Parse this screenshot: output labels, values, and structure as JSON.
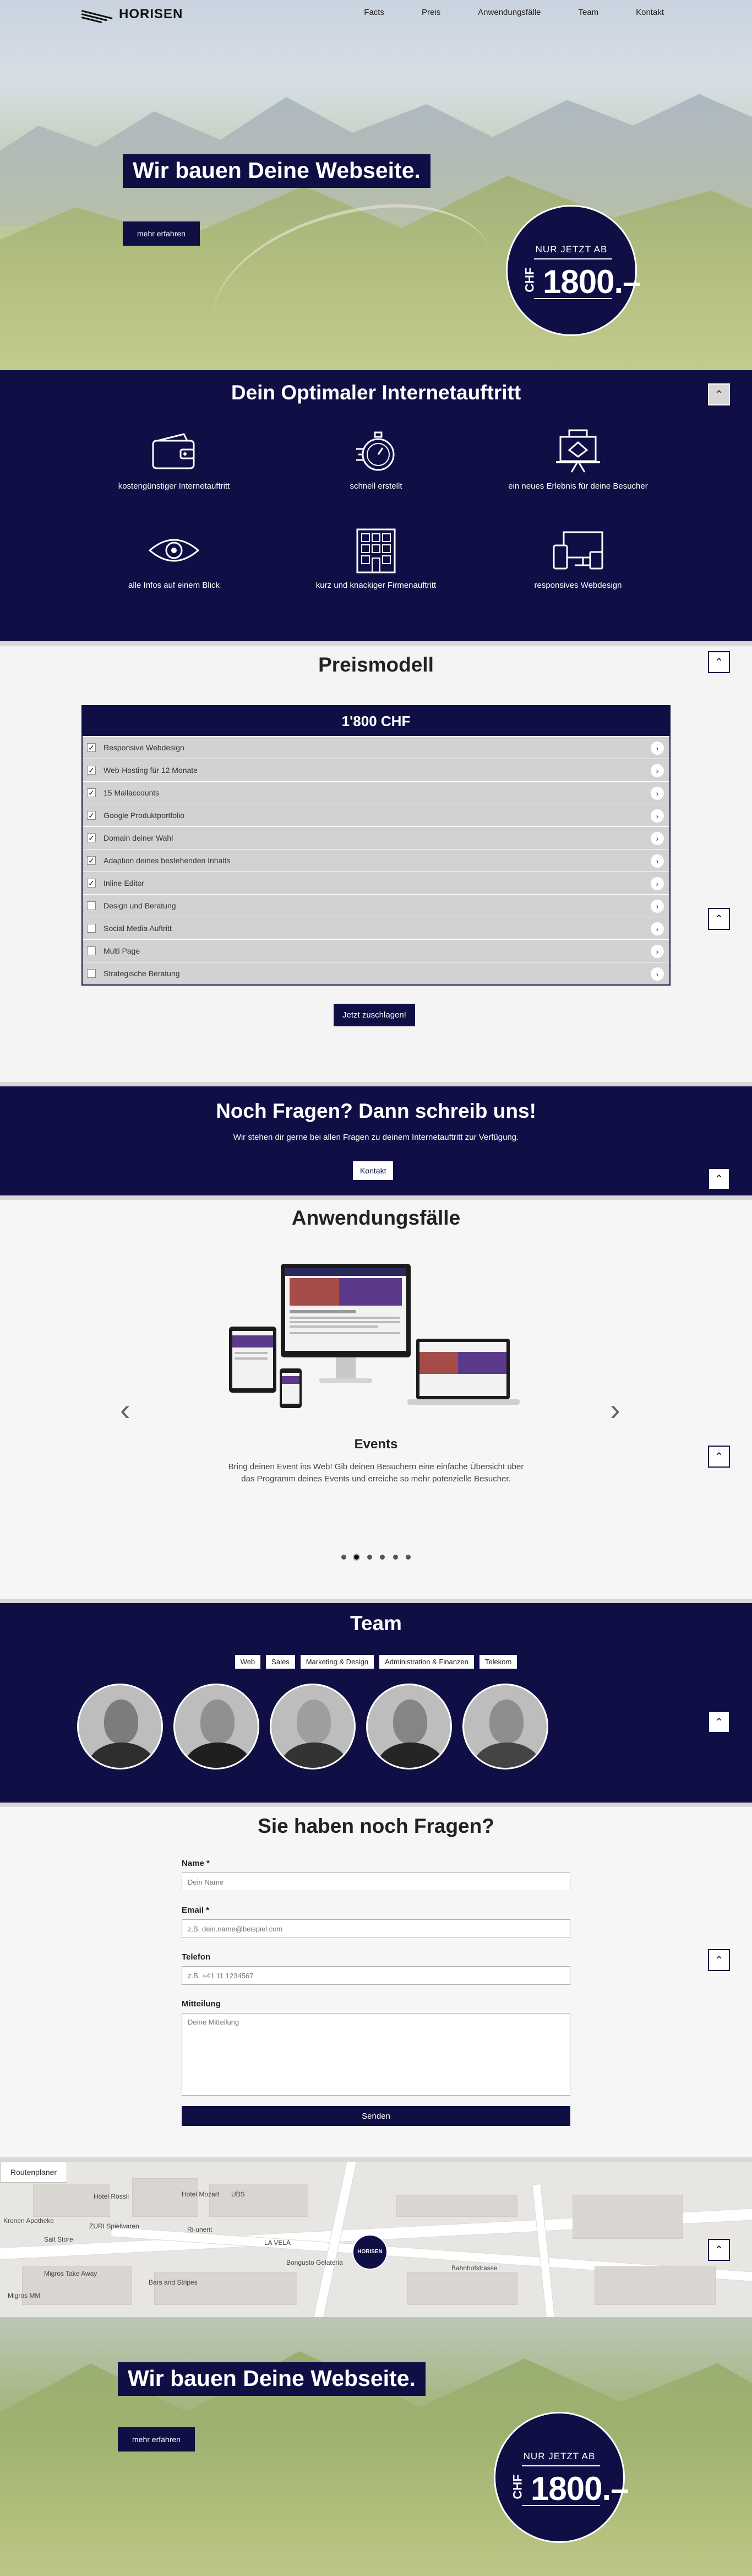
{
  "nav": {
    "logo": "HORISEN",
    "items": [
      "Facts",
      "Preis",
      "Anwendungsfälle",
      "Team",
      "Kontakt"
    ]
  },
  "hero": {
    "title": "Wir bauen Deine Webseite.",
    "button": "mehr erfahren",
    "badge_top": "NUR JETZT AB",
    "badge_currency": "CHF",
    "badge_amount": "1800.–"
  },
  "features": {
    "title": "Dein Optimaler Internetauftritt",
    "items": [
      {
        "label": "kostengünstiger Internetauftritt",
        "icon": "wallet-icon"
      },
      {
        "label": "schnell erstellt",
        "icon": "stopwatch-icon"
      },
      {
        "label": "ein neues Erlebnis für deine Besucher",
        "icon": "presentation-icon"
      },
      {
        "label": "alle Infos auf einem Blick",
        "icon": "eye-icon"
      },
      {
        "label": "kurz und knackiger Firmenauftritt",
        "icon": "building-icon"
      },
      {
        "label": "responsives Webdesign",
        "icon": "devices-icon"
      }
    ]
  },
  "preis": {
    "title": "Preismodell",
    "table_head": "1'800 CHF",
    "rows": [
      {
        "label": "Responsive Webdesign",
        "checked": true
      },
      {
        "label": "Web-Hosting für 12 Monate",
        "checked": true
      },
      {
        "label": "15 Mailaccounts",
        "checked": true
      },
      {
        "label": "Google Produktportfolio",
        "checked": true
      },
      {
        "label": "Domain deiner Wahl",
        "checked": true
      },
      {
        "label": "Adaption deines bestehenden Inhalts",
        "checked": true
      },
      {
        "label": "Inline Editor",
        "checked": true
      },
      {
        "label": "Design und Beratung",
        "checked": false
      },
      {
        "label": "Social Media Auftritt",
        "checked": false
      },
      {
        "label": "Multi Page",
        "checked": false
      },
      {
        "label": "Strategische Beratung",
        "checked": false
      }
    ],
    "button": "Jetzt zuschlagen!"
  },
  "fragen": {
    "title": "Noch Fragen? Dann schreib uns!",
    "text": "Wir stehen dir gerne bei allen Fragen zu deinem Internetauftritt zur Verfügung.",
    "button": "Kontakt"
  },
  "anwendungen": {
    "title": "Anwendungsfälle",
    "event_title": "Events",
    "event_text": "Bring deinen Event ins Web! Gib deinen Besuchern eine einfache Übersicht über das Programm deines Events und erreiche so mehr potenzielle Besucher.",
    "slide_count": 6,
    "active_slide": 2
  },
  "team": {
    "title": "Team",
    "tags": [
      "Web",
      "Sales",
      "Marketing & Design",
      "Administration & Finanzen",
      "Telekom"
    ],
    "members": 5
  },
  "kontakt": {
    "title": "Sie haben noch Fragen?",
    "fields": {
      "name_label": "Name *",
      "name_placeholder": "Dein Name",
      "email_label": "Email *",
      "email_placeholder": "z.B. dein.name@beispiel.com",
      "telefon_label": "Telefon",
      "telefon_placeholder": "z.B. +41 11 1234567",
      "mitteilung_label": "Mitteilung",
      "mitteilung_placeholder": "Deine Mitteilung"
    },
    "send": "Senden"
  },
  "map": {
    "routenplaner": "Routenplaner",
    "pin_label": "HORISEN",
    "labels": [
      "Hotel Rössli",
      "Hotel Mozart",
      "UBS",
      "ZURI Spielwaren",
      "Ri-unent",
      "LA VELA",
      "Bongusto Gelateria",
      "Kronen Apotheke",
      "Salt Store",
      "Migros Take Away",
      "Bars and Stripes",
      "Migros MM",
      "Bahnhofstrasse"
    ]
  },
  "colors": {
    "navy": "#0f0f45",
    "light": "#f4f4f4",
    "grey_row": "#d2d2d2"
  }
}
